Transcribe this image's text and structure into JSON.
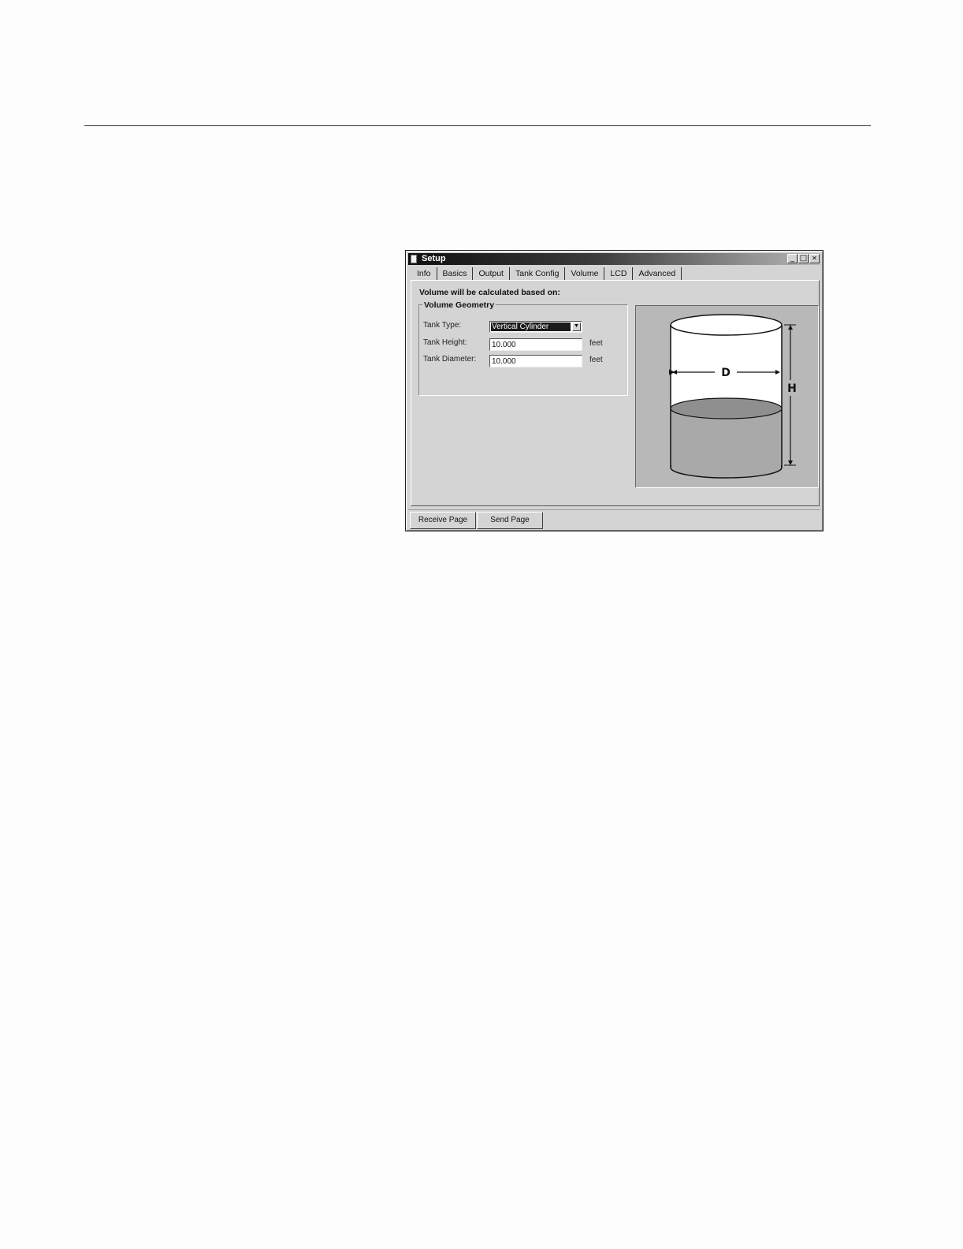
{
  "window": {
    "title": "Setup",
    "controls": {
      "minimize": "_",
      "maximize": "□",
      "close": "✕"
    }
  },
  "tabs": [
    {
      "label": "Info"
    },
    {
      "label": "Basics"
    },
    {
      "label": "Output"
    },
    {
      "label": "Tank Config"
    },
    {
      "label": "Volume",
      "active": true
    },
    {
      "label": "LCD"
    },
    {
      "label": "Advanced"
    }
  ],
  "volume_page": {
    "heading": "Volume will be calculated based on:",
    "group_title": "Volume Geometry",
    "tank_type": {
      "label": "Tank Type:",
      "value": "Vertical Cylinder"
    },
    "tank_height": {
      "label": "Tank Height:",
      "value": "10.000",
      "unit": "feet"
    },
    "tank_diameter": {
      "label": "Tank Diameter:",
      "value": "10.000",
      "unit": "feet"
    }
  },
  "diagram": {
    "diameter_label": "D",
    "height_label": "H",
    "liquid_color": "#a9a9a9",
    "tank_color": "#ffffff"
  },
  "buttons": {
    "receive": "Receive Page",
    "send": "Send Page"
  }
}
